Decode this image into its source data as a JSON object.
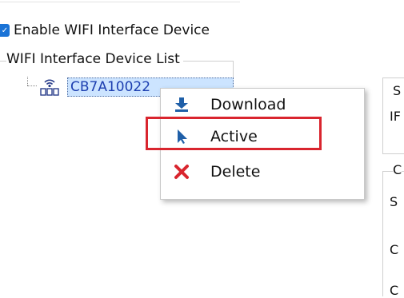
{
  "enable_checkbox": {
    "label": "Enable WIFI Interface Device",
    "checked": true
  },
  "device_list": {
    "title": "WIFI Interface Device List",
    "items": [
      {
        "label": "CB7A10022",
        "icon": "wifi-device-icon",
        "selected": true
      }
    ]
  },
  "context_menu": {
    "items": [
      {
        "label": "Download",
        "icon": "download-icon"
      },
      {
        "label": "Active",
        "icon": "pointer-arrow-icon",
        "highlighted": true
      },
      {
        "label": "Delete",
        "icon": "delete-x-icon"
      }
    ]
  },
  "right_panel": {
    "fragments": [
      "S",
      "IF",
      "C",
      "S",
      "C",
      "C"
    ]
  },
  "colors": {
    "highlight_border": "#d9252e",
    "selection_background": "#cce4ff",
    "checkbox_blue": "#1a73d6",
    "download_icon": "#1f5fa8",
    "active_icon": "#1f5fa8",
    "delete_icon": "#d9252e"
  }
}
